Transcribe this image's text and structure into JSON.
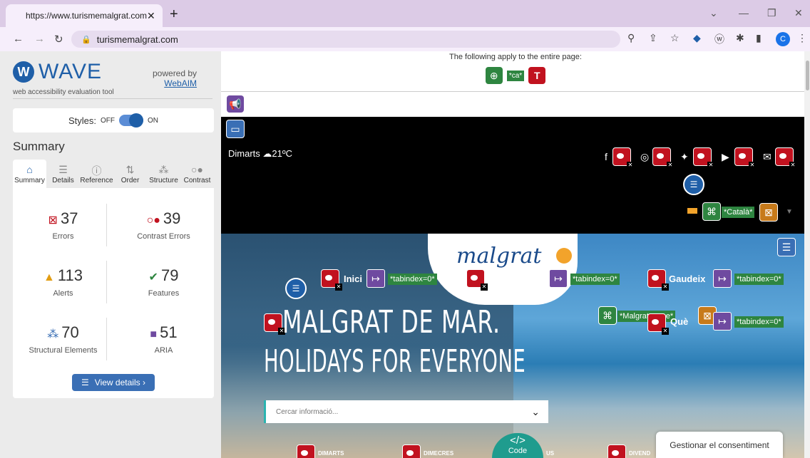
{
  "browser": {
    "tab_title": "https://www.turismemalgrat.com",
    "tab_close": "✕",
    "new_tab": "+",
    "url": "turismemalgrat.com",
    "profile_initial": "C"
  },
  "wave": {
    "logo_text": "WAVE",
    "logo_sub": "web accessibility evaluation tool",
    "powered_by": "powered by",
    "webaim": "WebAIM",
    "styles_label": "Styles:",
    "styles_off": "OFF",
    "styles_on": "ON",
    "summary_heading": "Summary",
    "tabs": [
      {
        "label": "Summary",
        "icon": "home-icon"
      },
      {
        "label": "Details",
        "icon": "list-icon"
      },
      {
        "label": "Reference",
        "icon": "info-icon"
      },
      {
        "label": "Order",
        "icon": "order-icon"
      },
      {
        "label": "Structure",
        "icon": "structure-icon"
      },
      {
        "label": "Contrast",
        "icon": "contrast-icon"
      }
    ],
    "stats": [
      {
        "count": "37",
        "label": "Errors",
        "color": "#c1121f"
      },
      {
        "count": "39",
        "label": "Contrast Errors",
        "color": "#c1121f"
      },
      {
        "count": "113",
        "label": "Alerts",
        "color": "#e29d13"
      },
      {
        "count": "79",
        "label": "Features",
        "color": "#2e8540"
      },
      {
        "count": "70",
        "label": "Structural Elements",
        "color": "#3a6fb5"
      },
      {
        "count": "51",
        "label": "ARIA",
        "color": "#6f4aa0"
      }
    ],
    "view_details": "View details ›"
  },
  "page": {
    "apply_text": "The following apply to the entire page:",
    "lang_tag": "*ca*",
    "weather": "Dimarts  ☁21ºC",
    "language_tag": "*Català*",
    "nav": [
      {
        "label": "Inici",
        "tag": "*tabindex=0*"
      },
      {
        "label": "",
        "tag": "*tabindex=0*"
      },
      {
        "label": "Gaudeix",
        "tag": "*tabindex=0*"
      },
      {
        "label": "Què",
        "tag": "*tabindex=0*"
      }
    ],
    "malgrat_tag": "*Malgrat...sme*",
    "hero_line1": "MALGRAT DE MAR.",
    "hero_line2": "HOLIDAYS FOR EVERYONE",
    "search_placeholder": "Cercar informació...",
    "bottom_nav": [
      "DIMARTS",
      "DIMECRES",
      "US",
      "DIVEND"
    ],
    "code_btn": "Code",
    "cookie": "Gestionar el consentiment"
  }
}
